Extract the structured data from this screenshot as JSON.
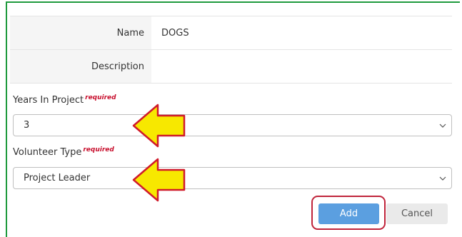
{
  "info": {
    "rows": [
      {
        "label": "Name",
        "value": "DOGS"
      },
      {
        "label": "Description",
        "value": ""
      }
    ]
  },
  "years_field": {
    "label": "Years In Project",
    "required": "required",
    "value": "3"
  },
  "volunteer_field": {
    "label": "Volunteer Type",
    "required": "required",
    "value": "Project Leader"
  },
  "buttons": {
    "add": "Add",
    "cancel": "Cancel"
  },
  "colors": {
    "frame": "#1f9a3d",
    "arrow_fill": "#f7e800",
    "arrow_stroke": "#d01a2a",
    "highlight": "#c0243b",
    "add_button": "#5b9fe0"
  }
}
